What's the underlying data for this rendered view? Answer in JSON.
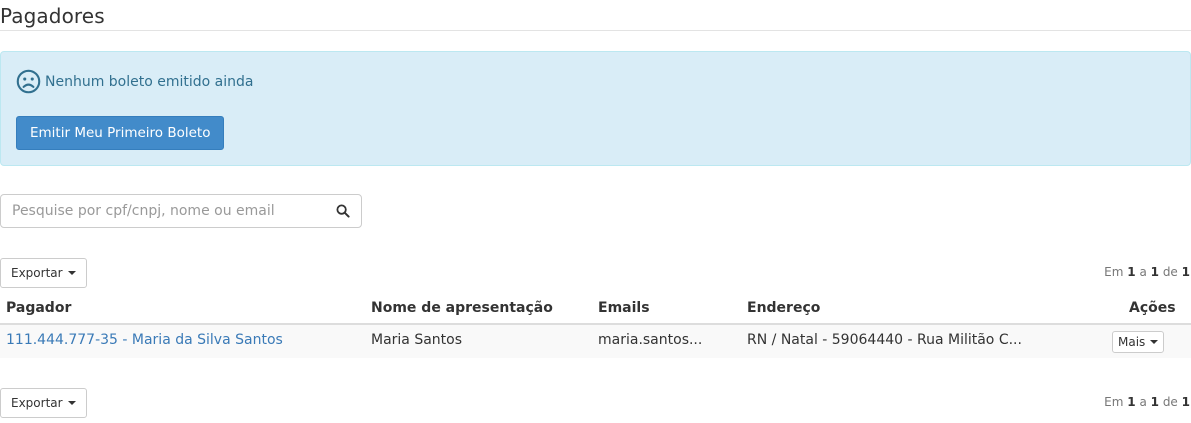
{
  "page": {
    "title": "Pagadores"
  },
  "alert": {
    "icon": "frown-icon",
    "message": "Nenhum boleto emitido ainda",
    "button_label": "Emitir Meu Primeiro Boleto"
  },
  "search": {
    "placeholder": "Pesquise por cpf/cnpj, nome ou email",
    "value": "",
    "icon": "search-icon"
  },
  "export": {
    "label": "Exportar"
  },
  "pagination": {
    "prefix": "Em",
    "from": "1",
    "sep": "a",
    "to": "1",
    "of_label": "de",
    "total": "1"
  },
  "table": {
    "columns": [
      "Pagador",
      "Nome de apresentação",
      "Emails",
      "Endereço",
      "Ações"
    ],
    "rows": [
      {
        "pagador": "111.444.777-35 - Maria da Silva Santos",
        "nome": "Maria Santos",
        "email": "maria.santos...",
        "endereco": "RN / Natal - 59064440 - Rua Militão C...",
        "action_label": "Mais"
      }
    ]
  },
  "colors": {
    "primary": "#428bca",
    "alert_bg": "#d9edf7",
    "alert_text": "#31708f",
    "link": "#3a7ab7"
  }
}
